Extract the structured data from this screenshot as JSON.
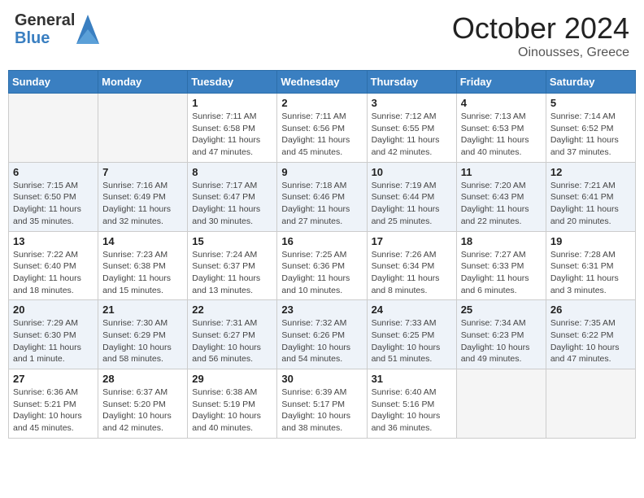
{
  "header": {
    "logo_general": "General",
    "logo_blue": "Blue",
    "month_title": "October 2024",
    "location": "Oinousses, Greece"
  },
  "calendar": {
    "days_of_week": [
      "Sunday",
      "Monday",
      "Tuesday",
      "Wednesday",
      "Thursday",
      "Friday",
      "Saturday"
    ],
    "weeks": [
      [
        {
          "day": "",
          "detail": ""
        },
        {
          "day": "",
          "detail": ""
        },
        {
          "day": "1",
          "detail": "Sunrise: 7:11 AM\nSunset: 6:58 PM\nDaylight: 11 hours and 47 minutes."
        },
        {
          "day": "2",
          "detail": "Sunrise: 7:11 AM\nSunset: 6:56 PM\nDaylight: 11 hours and 45 minutes."
        },
        {
          "day": "3",
          "detail": "Sunrise: 7:12 AM\nSunset: 6:55 PM\nDaylight: 11 hours and 42 minutes."
        },
        {
          "day": "4",
          "detail": "Sunrise: 7:13 AM\nSunset: 6:53 PM\nDaylight: 11 hours and 40 minutes."
        },
        {
          "day": "5",
          "detail": "Sunrise: 7:14 AM\nSunset: 6:52 PM\nDaylight: 11 hours and 37 minutes."
        }
      ],
      [
        {
          "day": "6",
          "detail": "Sunrise: 7:15 AM\nSunset: 6:50 PM\nDaylight: 11 hours and 35 minutes."
        },
        {
          "day": "7",
          "detail": "Sunrise: 7:16 AM\nSunset: 6:49 PM\nDaylight: 11 hours and 32 minutes."
        },
        {
          "day": "8",
          "detail": "Sunrise: 7:17 AM\nSunset: 6:47 PM\nDaylight: 11 hours and 30 minutes."
        },
        {
          "day": "9",
          "detail": "Sunrise: 7:18 AM\nSunset: 6:46 PM\nDaylight: 11 hours and 27 minutes."
        },
        {
          "day": "10",
          "detail": "Sunrise: 7:19 AM\nSunset: 6:44 PM\nDaylight: 11 hours and 25 minutes."
        },
        {
          "day": "11",
          "detail": "Sunrise: 7:20 AM\nSunset: 6:43 PM\nDaylight: 11 hours and 22 minutes."
        },
        {
          "day": "12",
          "detail": "Sunrise: 7:21 AM\nSunset: 6:41 PM\nDaylight: 11 hours and 20 minutes."
        }
      ],
      [
        {
          "day": "13",
          "detail": "Sunrise: 7:22 AM\nSunset: 6:40 PM\nDaylight: 11 hours and 18 minutes."
        },
        {
          "day": "14",
          "detail": "Sunrise: 7:23 AM\nSunset: 6:38 PM\nDaylight: 11 hours and 15 minutes."
        },
        {
          "day": "15",
          "detail": "Sunrise: 7:24 AM\nSunset: 6:37 PM\nDaylight: 11 hours and 13 minutes."
        },
        {
          "day": "16",
          "detail": "Sunrise: 7:25 AM\nSunset: 6:36 PM\nDaylight: 11 hours and 10 minutes."
        },
        {
          "day": "17",
          "detail": "Sunrise: 7:26 AM\nSunset: 6:34 PM\nDaylight: 11 hours and 8 minutes."
        },
        {
          "day": "18",
          "detail": "Sunrise: 7:27 AM\nSunset: 6:33 PM\nDaylight: 11 hours and 6 minutes."
        },
        {
          "day": "19",
          "detail": "Sunrise: 7:28 AM\nSunset: 6:31 PM\nDaylight: 11 hours and 3 minutes."
        }
      ],
      [
        {
          "day": "20",
          "detail": "Sunrise: 7:29 AM\nSunset: 6:30 PM\nDaylight: 11 hours and 1 minute."
        },
        {
          "day": "21",
          "detail": "Sunrise: 7:30 AM\nSunset: 6:29 PM\nDaylight: 10 hours and 58 minutes."
        },
        {
          "day": "22",
          "detail": "Sunrise: 7:31 AM\nSunset: 6:27 PM\nDaylight: 10 hours and 56 minutes."
        },
        {
          "day": "23",
          "detail": "Sunrise: 7:32 AM\nSunset: 6:26 PM\nDaylight: 10 hours and 54 minutes."
        },
        {
          "day": "24",
          "detail": "Sunrise: 7:33 AM\nSunset: 6:25 PM\nDaylight: 10 hours and 51 minutes."
        },
        {
          "day": "25",
          "detail": "Sunrise: 7:34 AM\nSunset: 6:23 PM\nDaylight: 10 hours and 49 minutes."
        },
        {
          "day": "26",
          "detail": "Sunrise: 7:35 AM\nSunset: 6:22 PM\nDaylight: 10 hours and 47 minutes."
        }
      ],
      [
        {
          "day": "27",
          "detail": "Sunrise: 6:36 AM\nSunset: 5:21 PM\nDaylight: 10 hours and 45 minutes."
        },
        {
          "day": "28",
          "detail": "Sunrise: 6:37 AM\nSunset: 5:20 PM\nDaylight: 10 hours and 42 minutes."
        },
        {
          "day": "29",
          "detail": "Sunrise: 6:38 AM\nSunset: 5:19 PM\nDaylight: 10 hours and 40 minutes."
        },
        {
          "day": "30",
          "detail": "Sunrise: 6:39 AM\nSunset: 5:17 PM\nDaylight: 10 hours and 38 minutes."
        },
        {
          "day": "31",
          "detail": "Sunrise: 6:40 AM\nSunset: 5:16 PM\nDaylight: 10 hours and 36 minutes."
        },
        {
          "day": "",
          "detail": ""
        },
        {
          "day": "",
          "detail": ""
        }
      ]
    ]
  }
}
